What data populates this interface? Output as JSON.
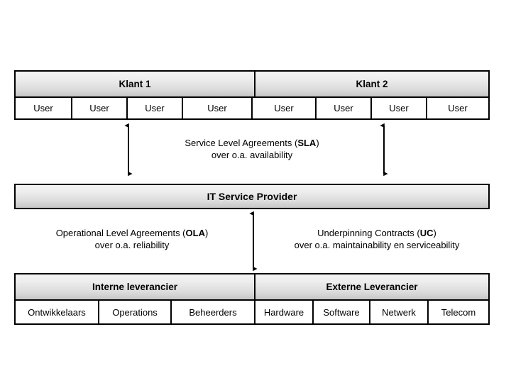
{
  "diagram": {
    "title": "ITIL Service Level Management agreement structure",
    "background_color": "#ffffff",
    "line_color": "#000000",
    "header_gradient_top": "#f4f4f4",
    "header_gradient_bottom": "#c6c6c6"
  },
  "customers": {
    "groups": [
      {
        "label": "Klant 1",
        "users": [
          "User",
          "User",
          "User",
          "User"
        ]
      },
      {
        "label": "Klant 2",
        "users": [
          "User",
          "User",
          "User",
          "User"
        ]
      }
    ]
  },
  "provider": {
    "label": "IT Service Provider"
  },
  "suppliers": {
    "groups": [
      {
        "label": "Interne leverancier",
        "items": [
          "Ontwikkelaars",
          "Operations",
          "Beheerders"
        ]
      },
      {
        "label": "Externe Leverancier",
        "items": [
          "Hardware",
          "Software",
          "Netwerk",
          "Telecom"
        ]
      }
    ]
  },
  "agreements": {
    "sla": {
      "line1_prefix": "Service Level Agreements (",
      "line1_acronym": "SLA",
      "line1_suffix": ")",
      "line2": "over o.a. availability"
    },
    "ola": {
      "line1_prefix": "Operational Level Agreements (",
      "line1_acronym": "OLA",
      "line1_suffix": ")",
      "line2": "over o.a. reliability"
    },
    "uc": {
      "line1_prefix": "Underpinning Contracts (",
      "line1_acronym": "UC",
      "line1_suffix": ")",
      "line2": "over o.a. maintainability en serviceability"
    }
  },
  "connectors": [
    {
      "name": "sla-arrow-left",
      "from": "Klant 1",
      "to": "IT Service Provider",
      "double_headed": true
    },
    {
      "name": "sla-arrow-right",
      "from": "Klant 2",
      "to": "IT Service Provider",
      "double_headed": true
    },
    {
      "name": "supplier-arrow",
      "from": "IT Service Provider",
      "to": "Leveranciers",
      "double_headed": true
    }
  ]
}
